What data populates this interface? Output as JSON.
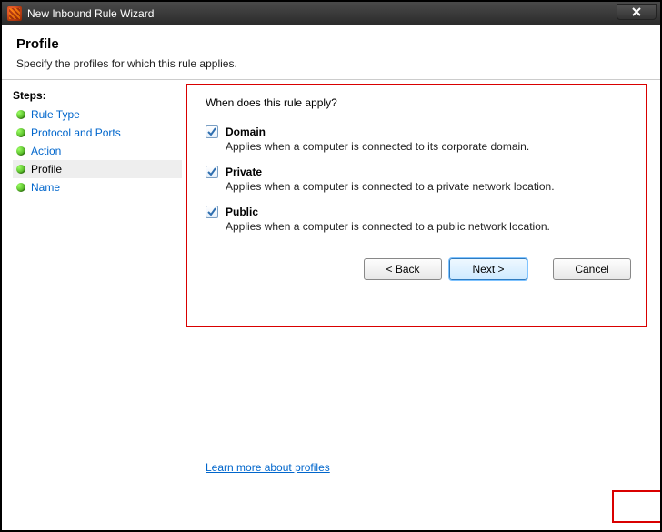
{
  "window": {
    "title": "New Inbound Rule Wizard"
  },
  "header": {
    "title": "Profile",
    "subtitle": "Specify the profiles for which this rule applies."
  },
  "sidebar": {
    "title": "Steps:",
    "items": [
      {
        "label": "Rule Type",
        "current": false
      },
      {
        "label": "Protocol and Ports",
        "current": false
      },
      {
        "label": "Action",
        "current": false
      },
      {
        "label": "Profile",
        "current": true
      },
      {
        "label": "Name",
        "current": false
      }
    ]
  },
  "content": {
    "question": "When does this rule apply?",
    "profiles": [
      {
        "key": "domain",
        "label": "Domain",
        "checked": true,
        "desc": "Applies when a computer is connected to its corporate domain."
      },
      {
        "key": "private",
        "label": "Private",
        "checked": true,
        "desc": "Applies when a computer is connected to a private network location."
      },
      {
        "key": "public",
        "label": "Public",
        "checked": true,
        "desc": "Applies when a computer is connected to a public network location."
      }
    ],
    "learn_more": "Learn more about profiles"
  },
  "buttons": {
    "back": "< Back",
    "next": "Next >",
    "cancel": "Cancel"
  }
}
